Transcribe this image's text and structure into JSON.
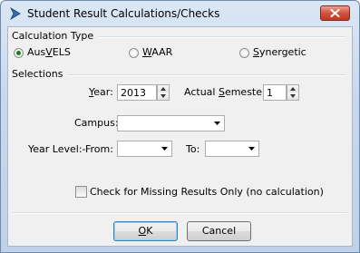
{
  "window": {
    "title": "Student Result Calculations/Checks",
    "close_label": "×"
  },
  "calculation_type": {
    "heading": "Calculation Type",
    "options": [
      {
        "pre": "Aus",
        "key": "V",
        "post": "ELS",
        "selected": true
      },
      {
        "pre": "",
        "key": "W",
        "post": "AAR",
        "selected": false
      },
      {
        "pre": "",
        "key": "S",
        "post": "ynergetic",
        "selected": false
      }
    ]
  },
  "selections": {
    "heading": "Selections",
    "year": {
      "key": "Y",
      "post": "ear:",
      "value": "2013"
    },
    "semester": {
      "pre": "Actual ",
      "key": "S",
      "post": "emester:",
      "value": "1"
    },
    "campus": {
      "label": "Campus:",
      "value": ""
    },
    "year_level": {
      "label": "Year Level:-",
      "from_label": "From:",
      "from_value": "",
      "to_label": "To:",
      "to_value": ""
    }
  },
  "check_missing": {
    "label": "Check for Missing Results Only (no calculation)",
    "checked": false
  },
  "buttons": {
    "ok": {
      "key": "O",
      "post": "K"
    },
    "cancel": "Cancel"
  },
  "colors": {
    "radio_selected": "#1e7a1e",
    "close_button": "#c13a22",
    "default_button_border": "#3c7fb1"
  }
}
